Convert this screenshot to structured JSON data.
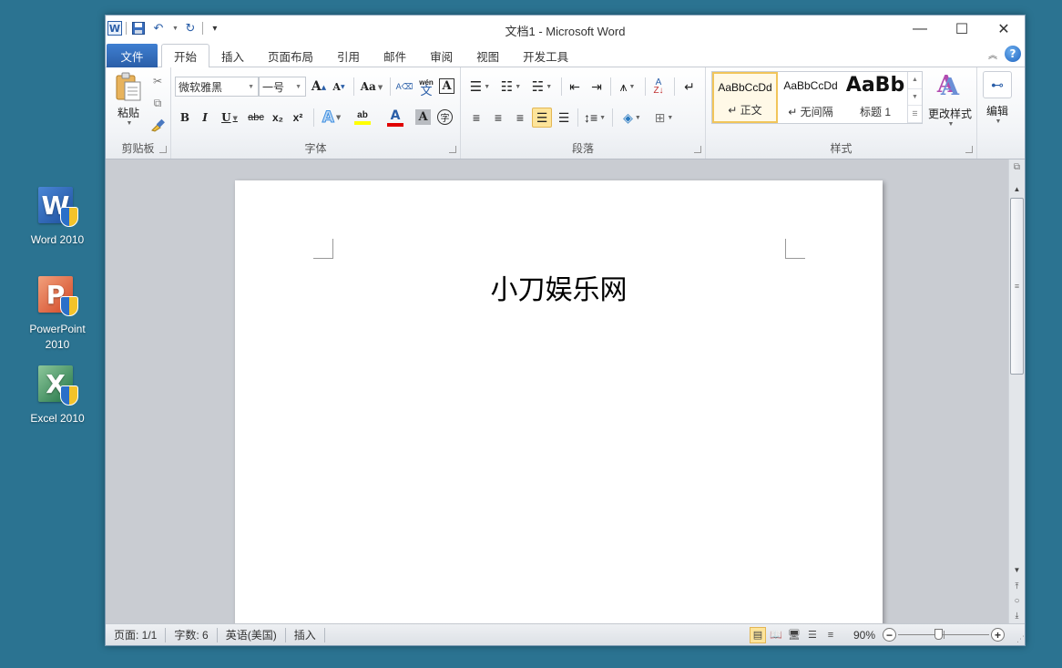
{
  "desktop": {
    "icons": [
      {
        "label_line1": "Word 2010",
        "label_line2": "",
        "letter": "W",
        "color": "#2a5ea8"
      },
      {
        "label_line1": "PowerPoint",
        "label_line2": "2010",
        "letter": "P",
        "color": "#d24726"
      },
      {
        "label_line1": "Excel 2010",
        "label_line2": "",
        "letter": "X",
        "color": "#207245"
      }
    ]
  },
  "window": {
    "title": "文档1  -  Microsoft Word",
    "app_logo": "W",
    "qat": {
      "save": "save-icon",
      "undo": "↶",
      "redo": "↻",
      "customize": "▾"
    },
    "controls": {
      "minimize": "—",
      "maximize": "☐",
      "close": "✕"
    }
  },
  "tabs": [
    {
      "label": "文件",
      "type": "file"
    },
    {
      "label": "开始",
      "active": true
    },
    {
      "label": "插入"
    },
    {
      "label": "页面布局"
    },
    {
      "label": "引用"
    },
    {
      "label": "邮件"
    },
    {
      "label": "审阅"
    },
    {
      "label": "视图"
    },
    {
      "label": "开发工具"
    }
  ],
  "ribbon": {
    "clipboard": {
      "label": "剪贴板",
      "paste": "粘贴"
    },
    "font": {
      "label": "字体",
      "font_name": "微软雅黑",
      "font_size": "一号",
      "grow": "A",
      "shrink": "A",
      "change_case": "Aa",
      "bold": "B",
      "italic": "I",
      "underline": "U",
      "strikethrough": "abc",
      "subscript": "x₂",
      "superscript": "x²",
      "text_effects": "A",
      "highlight": "ab",
      "font_color": "A",
      "char_shading": "A",
      "enclose": "字",
      "phonetic": "wén",
      "border_char": "A",
      "highlight_color": "#ffff00",
      "font_color_value": "#e00000"
    },
    "paragraph": {
      "label": "段落"
    },
    "styles": {
      "label": "样式",
      "items": [
        {
          "sample": "AaBbCcDd",
          "name": "↵ 正文",
          "selected": true
        },
        {
          "sample": "AaBbCcDd",
          "name": "↵ 无间隔"
        },
        {
          "sample": "AaBb",
          "name": "标题 1"
        }
      ],
      "change_styles": "更改样式"
    },
    "editing": {
      "label": "编辑"
    }
  },
  "document": {
    "text": "小刀娱乐网"
  },
  "statusbar": {
    "page": "页面: 1/1",
    "words": "字数: 6",
    "language": "英语(美国)",
    "mode": "插入",
    "zoom": "90%",
    "zoom_value_percent": 90
  }
}
